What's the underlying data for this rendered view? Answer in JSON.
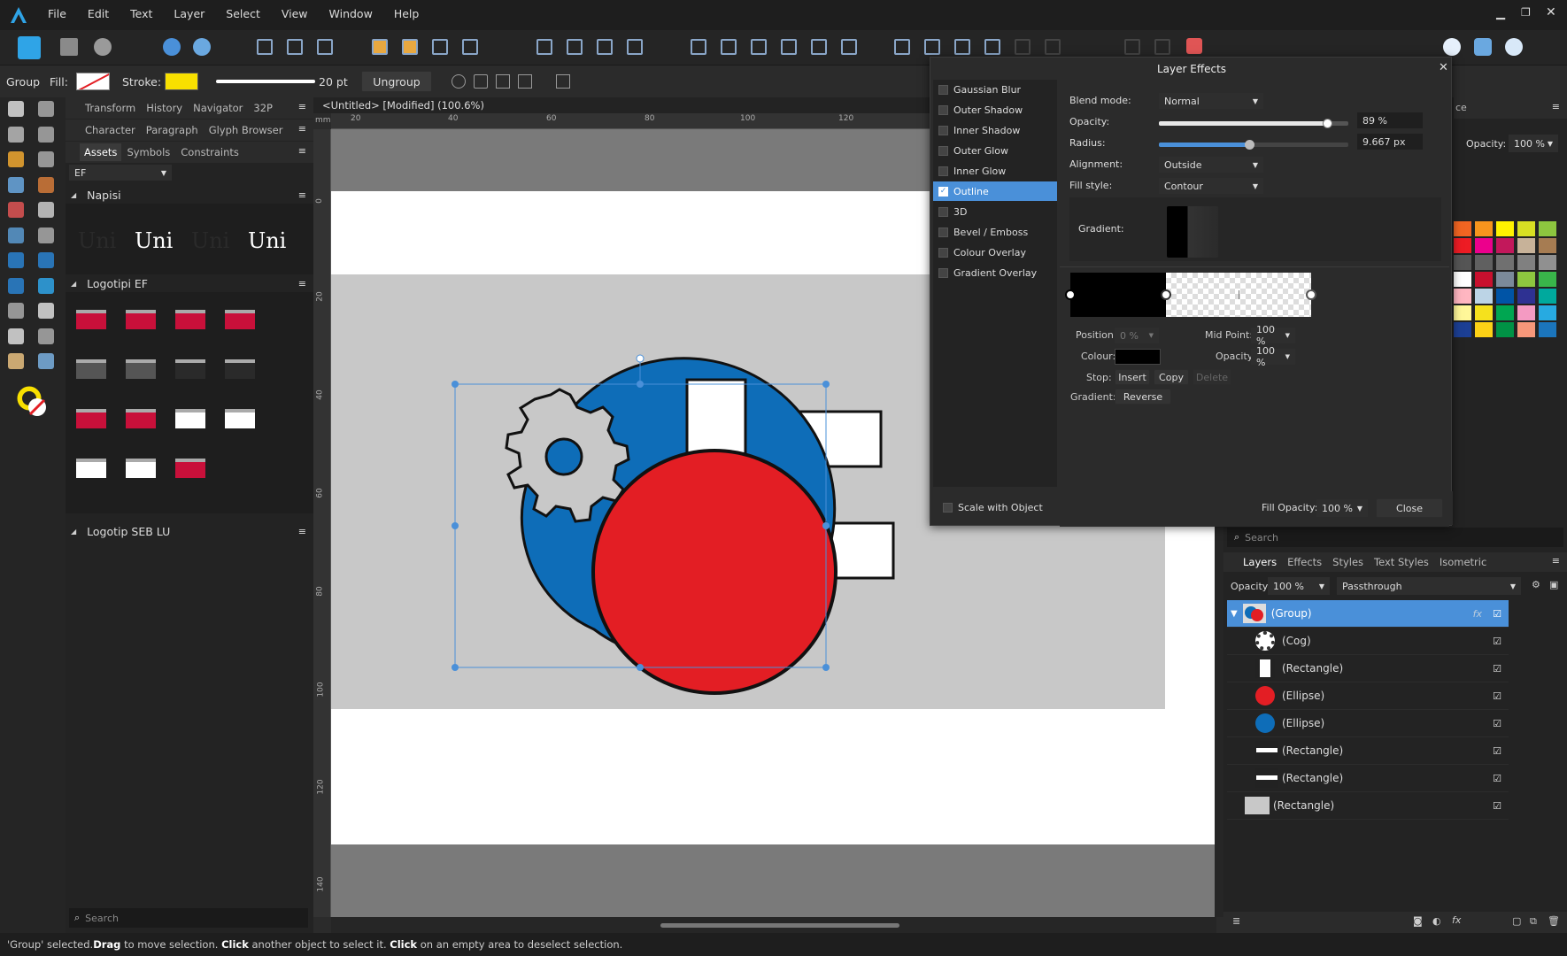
{
  "menu": {
    "items": [
      "File",
      "Edit",
      "Text",
      "Layer",
      "Select",
      "View",
      "Window",
      "Help"
    ]
  },
  "context": {
    "selection": "Group",
    "fill_label": "Fill:",
    "stroke_label": "Stroke:",
    "stroke_width": "20 pt",
    "ungroup": "Ungroup"
  },
  "left_panels": {
    "row1_tabs": [
      "Transform",
      "History",
      "Navigator",
      "32P"
    ],
    "row2_tabs": [
      "Character",
      "Paragraph",
      "Glyph Browser"
    ],
    "row3_tabs": [
      "Assets",
      "Symbols",
      "Constraints"
    ],
    "category": "EF",
    "napisi_title": "Napisi",
    "napisi_samples": [
      "Uni",
      "Uni",
      "Uni",
      "Uni"
    ],
    "logotipi_ef_title": "Logotipi EF",
    "logotip_seb_title": "Logotip SEB LU",
    "search_placeholder": "Search"
  },
  "document": {
    "title": "<Untitled> [Modified] (100.6%)",
    "ruler_unit": "mm",
    "ruler_h": [
      "20",
      "40",
      "60",
      "80",
      "100",
      "120"
    ],
    "ruler_v": [
      "0",
      "20",
      "40",
      "60",
      "80",
      "100",
      "120",
      "140"
    ]
  },
  "dialog": {
    "title": "Layer Effects",
    "effects": [
      {
        "label": "Gaussian Blur",
        "checked": false
      },
      {
        "label": "Outer Shadow",
        "checked": false
      },
      {
        "label": "Inner Shadow",
        "checked": false
      },
      {
        "label": "Outer Glow",
        "checked": false
      },
      {
        "label": "Inner Glow",
        "checked": false
      },
      {
        "label": "Outline",
        "checked": true
      },
      {
        "label": "3D",
        "checked": false
      },
      {
        "label": "Bevel / Emboss",
        "checked": false
      },
      {
        "label": "Colour Overlay",
        "checked": false
      },
      {
        "label": "Gradient Overlay",
        "checked": false
      }
    ],
    "blend_mode_label": "Blend mode:",
    "blend_mode": "Normal",
    "opacity_label": "Opacity:",
    "opacity_value": "89 %",
    "opacity_fraction": 0.89,
    "radius_label": "Radius:",
    "radius_value": "9.667 px",
    "alignment_label": "Alignment:",
    "alignment": "Outside",
    "fill_style_label": "Fill style:",
    "fill_style": "Contour",
    "gradient_label": "Gradient:",
    "position_label": "Position:",
    "position_value": "0 %",
    "midpoint_label": "Mid Point:",
    "midpoint_value": "100 %",
    "colour_label": "Colour:",
    "stop_opacity_label": "Opacity:",
    "stop_opacity_value": "100 %",
    "stop_label": "Stop:",
    "insert": "Insert",
    "copy": "Copy",
    "delete": "Delete",
    "gradient2_label": "Gradient:",
    "reverse": "Reverse",
    "scale_with_object": "Scale with Object",
    "fill_opacity_label": "Fill Opacity:",
    "fill_opacity_value": "100 %",
    "close": "Close"
  },
  "right_panel": {
    "opacity_label": "Opacity:",
    "opacity_value": "100 %",
    "partial_tab": "ce",
    "swatches": [
      "#f26522",
      "#f7941d",
      "#fff200",
      "#d7df23",
      "#8dc63f",
      "#ed1c24",
      "#ec008c",
      "#c2185b",
      "#c7b299",
      "#a67c52",
      "#555555",
      "#606060",
      "#707070",
      "#808080",
      "#909090",
      "#ffffff",
      "#c8102e",
      "#7b8a9a",
      "#8dc63f",
      "#39b54a",
      "#ffb6c1",
      "#bcd4e6",
      "#0054a6",
      "#2e3192",
      "#00a99d",
      "#fff799",
      "#f5e11d",
      "#00a651",
      "#f49ac2",
      "#27aae1",
      "#1c3f94",
      "#fcd116",
      "#009245",
      "#f7977a",
      "#1b75bc"
    ]
  },
  "layers": {
    "search_placeholder": "Search",
    "tabs": [
      "Layers",
      "Effects",
      "Styles",
      "Text Styles",
      "Isometric"
    ],
    "opacity_label": "Opacity:",
    "opacity_value": "100 %",
    "blend": "Passthrough",
    "items": [
      {
        "name": "(Group)"
      },
      {
        "name": "(Cog)"
      },
      {
        "name": "(Rectangle)"
      },
      {
        "name": "(Ellipse)"
      },
      {
        "name": "(Ellipse)"
      },
      {
        "name": "(Rectangle)"
      },
      {
        "name": "(Rectangle)"
      },
      {
        "name": "(Rectangle)"
      }
    ]
  },
  "status": {
    "p1": "'Group' selected. ",
    "p2": "Drag",
    "p3": " to move selection. ",
    "p4": "Click",
    "p5": " another object to select it. ",
    "p6": "Click",
    "p7": " on an empty area to deselect selection."
  },
  "colors": {
    "accent": "#4a90d9",
    "red": "#e31e24",
    "blue": "#0e6db8",
    "yellow": "#f8e000"
  }
}
